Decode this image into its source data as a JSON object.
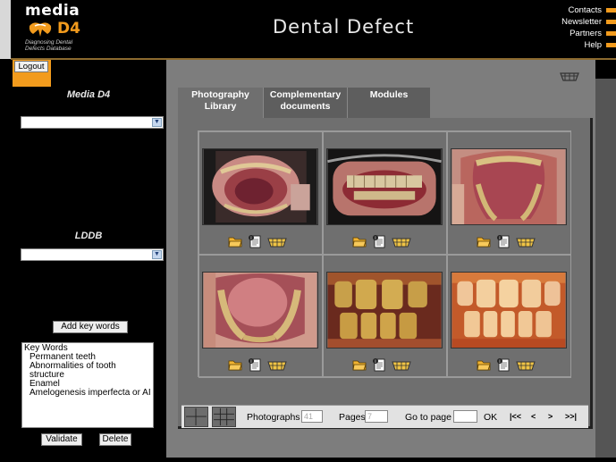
{
  "header": {
    "logo_media": "media",
    "logo_d4": "D4",
    "logo_subtitle_line1": "Diagnosing Dental",
    "logo_subtitle_line2": "Defects Database",
    "title": "Dental Defect",
    "links": [
      "Contacts",
      "Newsletter",
      "Partners",
      "Help"
    ],
    "accent_color": "#f29b1d"
  },
  "sidebar": {
    "logout_label": "Logout",
    "media_d4_label": "Media D4",
    "media_d4_select_value": "",
    "lddb_label": "LDDB",
    "lddb_select_value": "",
    "add_keywords_label": "Add key words",
    "keywords_title": "Key Words",
    "keywords": [
      "Permanent teeth",
      "Abnormalities of tooth structure",
      "Enamel",
      "Amelogenesis imperfecta or AI"
    ],
    "validate_label": "Validate",
    "delete_label": "Delete"
  },
  "tabs": [
    {
      "line1": "Photography",
      "line2": "Library"
    },
    {
      "line1": "Complementary",
      "line2": "documents"
    },
    {
      "line1": "Modules",
      "line2": ""
    }
  ],
  "photos": [
    {
      "name": "photo-1",
      "icons": [
        "folder-icon",
        "document-info-icon",
        "basket-icon"
      ]
    },
    {
      "name": "photo-2",
      "icons": [
        "folder-icon",
        "document-info-icon",
        "basket-icon"
      ]
    },
    {
      "name": "photo-3",
      "icons": [
        "folder-icon",
        "document-info-icon",
        "basket-icon"
      ]
    },
    {
      "name": "photo-4",
      "icons": [
        "folder-icon",
        "document-info-icon",
        "basket-icon"
      ]
    },
    {
      "name": "photo-5",
      "icons": [
        "folder-icon",
        "document-info-icon",
        "basket-icon"
      ]
    },
    {
      "name": "photo-6",
      "icons": [
        "folder-icon",
        "document-info-icon",
        "basket-icon"
      ]
    }
  ],
  "pager": {
    "photographs_label": "Photographs",
    "photographs_count": "41",
    "pages_label": "Pages",
    "pages_count": "7",
    "goto_label": "Go to page",
    "goto_value": "",
    "ok_label": "OK",
    "first": "|<<",
    "prev": "<",
    "next": ">",
    "last": ">>|"
  }
}
